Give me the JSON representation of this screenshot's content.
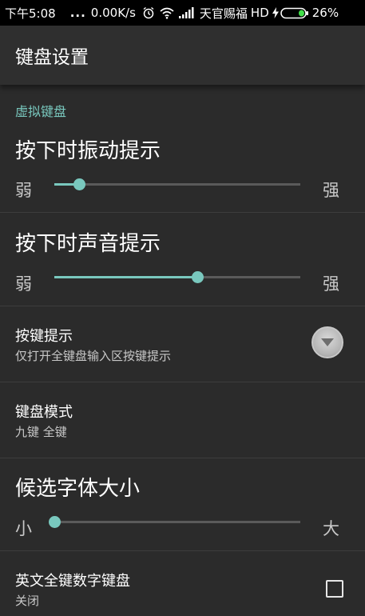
{
  "status_bar": {
    "time": "下午5:08",
    "dots": "...",
    "speed": "0.00K/s",
    "carrier": "天官赐福",
    "network": "HD",
    "battery_percent": "26%",
    "battery_level": 0.26,
    "icons": [
      "alarm-icon",
      "wifi-icon",
      "signal-icon",
      "charging-icon",
      "battery-icon"
    ]
  },
  "app_bar": {
    "title": "键盘设置"
  },
  "section": {
    "header": "虚拟键盘"
  },
  "vibration": {
    "title": "按下时振动提示",
    "min_label": "弱",
    "max_label": "强",
    "value": 0.1
  },
  "sound": {
    "title": "按下时声音提示",
    "min_label": "弱",
    "max_label": "强",
    "value": 0.58
  },
  "key_hint": {
    "title": "按键提示",
    "summary": "仅打开全键盘输入区按键提示"
  },
  "keyboard_mode": {
    "title": "键盘模式",
    "summary": "九键 全键"
  },
  "candidate_font": {
    "title": "候选字体大小",
    "min_label": "小",
    "max_label": "大",
    "value": 0.0
  },
  "english_numeric": {
    "title": "英文全键数字键盘",
    "summary": "关闭",
    "checked": false
  },
  "colors": {
    "accent": "#79c8be",
    "background": "#2b2b2b",
    "app_bar": "#2f2f2f",
    "status_bar": "#000000"
  }
}
